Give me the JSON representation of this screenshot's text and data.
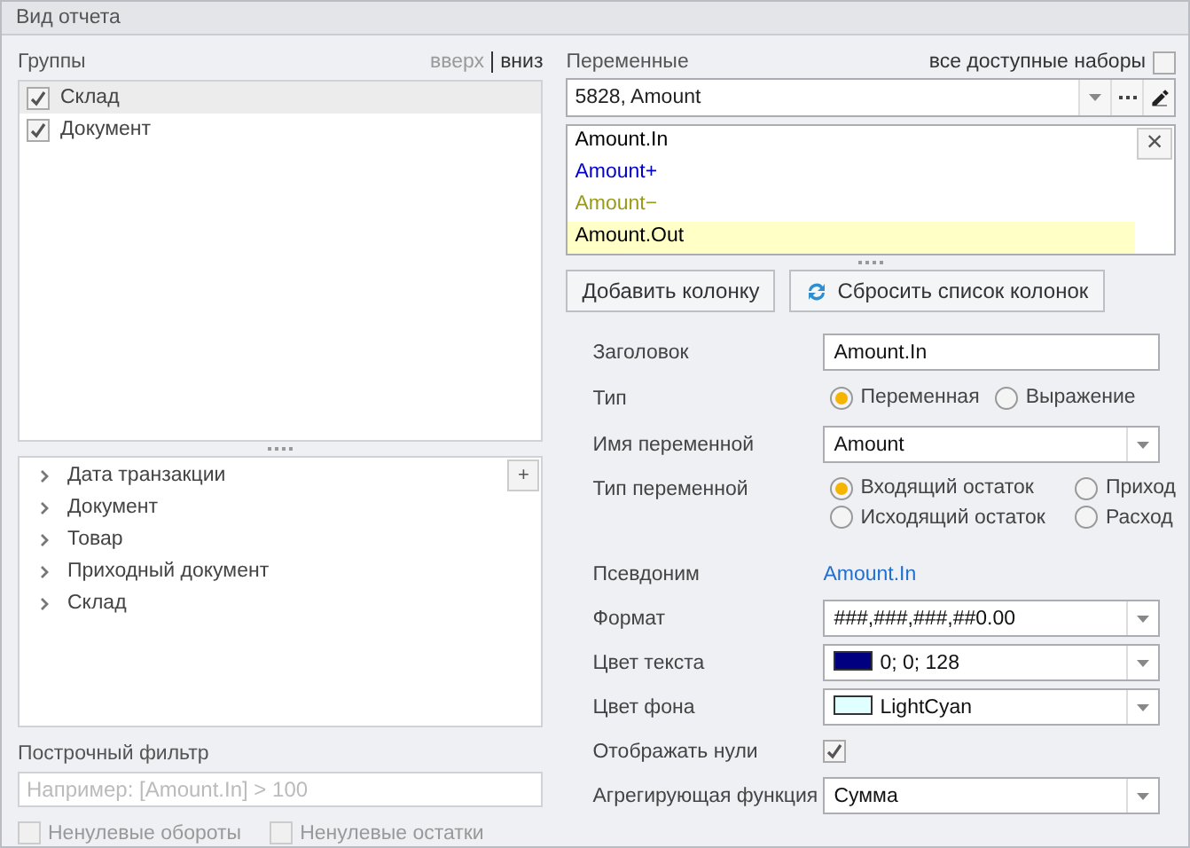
{
  "window": {
    "title": "Вид отчета"
  },
  "groups": {
    "label": "Группы",
    "up": {
      "label": "вверх",
      "disabled": true
    },
    "down": {
      "label": "вниз",
      "disabled": false
    },
    "items": [
      {
        "label": "Склад",
        "checked": true,
        "selected": true
      },
      {
        "label": "Документ",
        "checked": true,
        "selected": false
      }
    ]
  },
  "tree": {
    "add_button": "+",
    "items": [
      {
        "label": "Дата транзакции",
        "expanded": false
      },
      {
        "label": "Документ",
        "expanded": false
      },
      {
        "label": "Товар",
        "expanded": false
      },
      {
        "label": "Приходный документ",
        "expanded": false
      },
      {
        "label": "Склад",
        "expanded": false
      }
    ]
  },
  "filter": {
    "label": "Построчный фильтр",
    "placeholder": "Например: [Amount.In] > 100",
    "checkboxes": [
      {
        "label": "Ненулевые обороты",
        "checked": false,
        "disabled": true
      },
      {
        "label": "Ненулевые остатки",
        "checked": false,
        "disabled": true
      }
    ]
  },
  "variables": {
    "label": "Переменные",
    "all_sets": {
      "label": "все доступные наборы",
      "checked": false
    },
    "combo_value": "5828, Amount",
    "items": [
      {
        "label": "Amount.In",
        "color": "#000000",
        "selected": false
      },
      {
        "label": "Amount+",
        "color": "#0000cc",
        "selected": false
      },
      {
        "label": "Amount−",
        "color": "#9a9a1a",
        "selected": false
      },
      {
        "label": "Amount.Out",
        "color": "#000000",
        "selected": true
      }
    ],
    "remove_button": "×"
  },
  "buttons": [
    {
      "label": "Добавить колонку",
      "kind": "plain"
    },
    {
      "label": "Сбросить список колонок",
      "kind": "refresh"
    }
  ],
  "form": [
    {
      "kind": "text",
      "label": "Заголовок",
      "value": "Amount.In"
    },
    {
      "kind": "radio",
      "label": "Тип",
      "options": [
        {
          "label": "Переменная",
          "selected": true
        },
        {
          "label": "Выражение",
          "selected": false
        }
      ]
    },
    {
      "kind": "select",
      "label": "Имя переменной",
      "value": "Amount"
    },
    {
      "kind": "radio2",
      "label": "Тип переменной",
      "options": [
        {
          "label": "Входящий остаток",
          "selected": true
        },
        {
          "label": "Приход",
          "selected": false
        },
        {
          "label": "Исходящий остаток",
          "selected": false
        },
        {
          "label": "Расход",
          "selected": false
        }
      ]
    },
    {
      "kind": "link",
      "label": "Псевдоним",
      "value": "Amount.In"
    },
    {
      "kind": "select",
      "label": "Формат",
      "value": "###,###,###,##0.00"
    },
    {
      "kind": "color",
      "label": "Цвет текста",
      "value": "0; 0; 128",
      "color": "#000080"
    },
    {
      "kind": "color",
      "label": "Цвет фона",
      "value": "LightCyan",
      "color": "#e0ffff"
    },
    {
      "kind": "check",
      "label": "Отображать нули",
      "checked": true
    },
    {
      "kind": "select",
      "label": "Агрегирующая функция",
      "value": "Сумма"
    }
  ]
}
